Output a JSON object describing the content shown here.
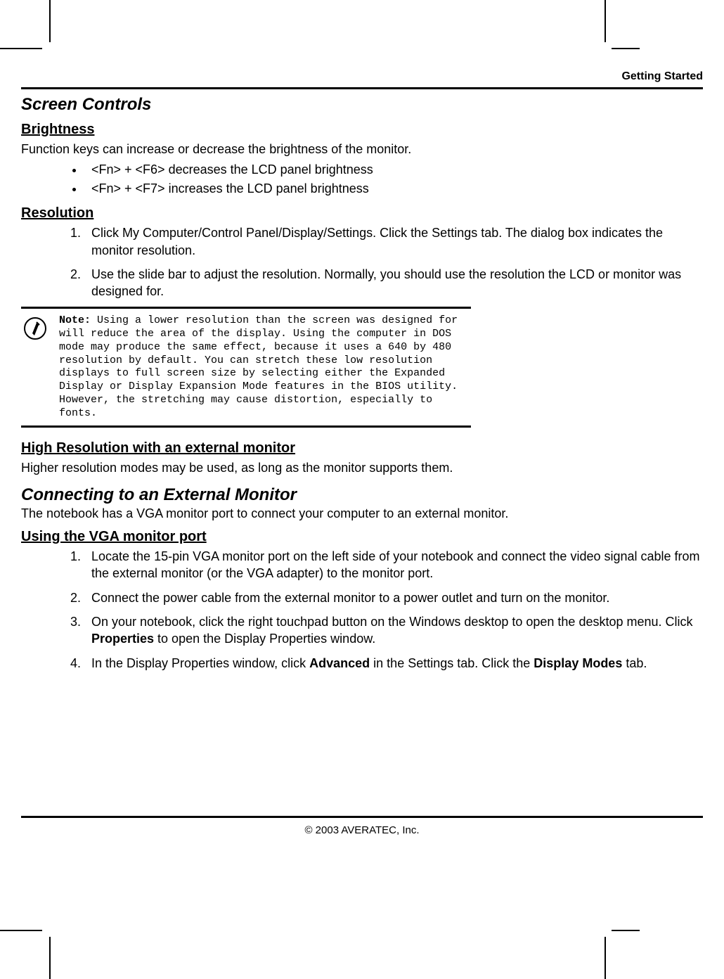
{
  "header": {
    "section_label": "Getting Started"
  },
  "sections": {
    "screen_controls": {
      "title": "Screen Controls",
      "brightness": {
        "heading": "Brightness",
        "intro": "Function keys can increase or decrease the brightness of the monitor.",
        "items": [
          "<Fn> + <F6> decreases the LCD panel brightness",
          "<Fn> + <F7> increases the LCD panel brightness"
        ]
      },
      "resolution": {
        "heading": "Resolution",
        "steps": [
          "Click My Computer/Control Panel/Display/Settings. Click the Settings tab. The dialog box indicates the monitor resolution.",
          "Use the slide bar to adjust the resolution. Normally, you should use the resolution the LCD or monitor was designed for."
        ]
      },
      "note": {
        "label": "Note:",
        "text": "Using a lower resolution than the screen was designed for will reduce the area of the display. Using the computer in DOS mode may produce the same effect, because it uses a 640 by 480 resolution by default. You can stretch these low resolution displays to full screen size by selecting either the Expanded Display or Display Expansion Mode features in the BIOS utility. However, the stretching may cause distortion, especially to fonts."
      },
      "high_res": {
        "heading": "High Resolution with an external monitor",
        "text": "Higher resolution modes may be used, as long as the monitor supports them."
      }
    },
    "external_monitor": {
      "title": "Connecting to an External Monitor",
      "intro": "The notebook has a VGA monitor port to connect your computer to an external monitor.",
      "vga": {
        "heading": "Using the VGA monitor port",
        "steps": {
          "s1": "Locate the 15-pin VGA monitor port on the left side of your notebook and connect the video signal cable from the external monitor (or the VGA adapter) to the monitor port.",
          "s2": "Connect the power cable from the external monitor to a power outlet and turn on the monitor.",
          "s3_a": "On your notebook, click the right touchpad button on the Windows desktop to open the desktop menu. Click ",
          "s3_b": "Properties",
          "s3_c": " to open the Display Properties window.",
          "s4_a": "In the Display Properties window, click ",
          "s4_b": "Advanced",
          "s4_c": " in the Settings tab. Click the ",
          "s4_d": "Display Modes",
          "s4_e": " tab."
        }
      }
    }
  },
  "footer": {
    "copyright": "© 2003 AVERATEC, Inc."
  }
}
